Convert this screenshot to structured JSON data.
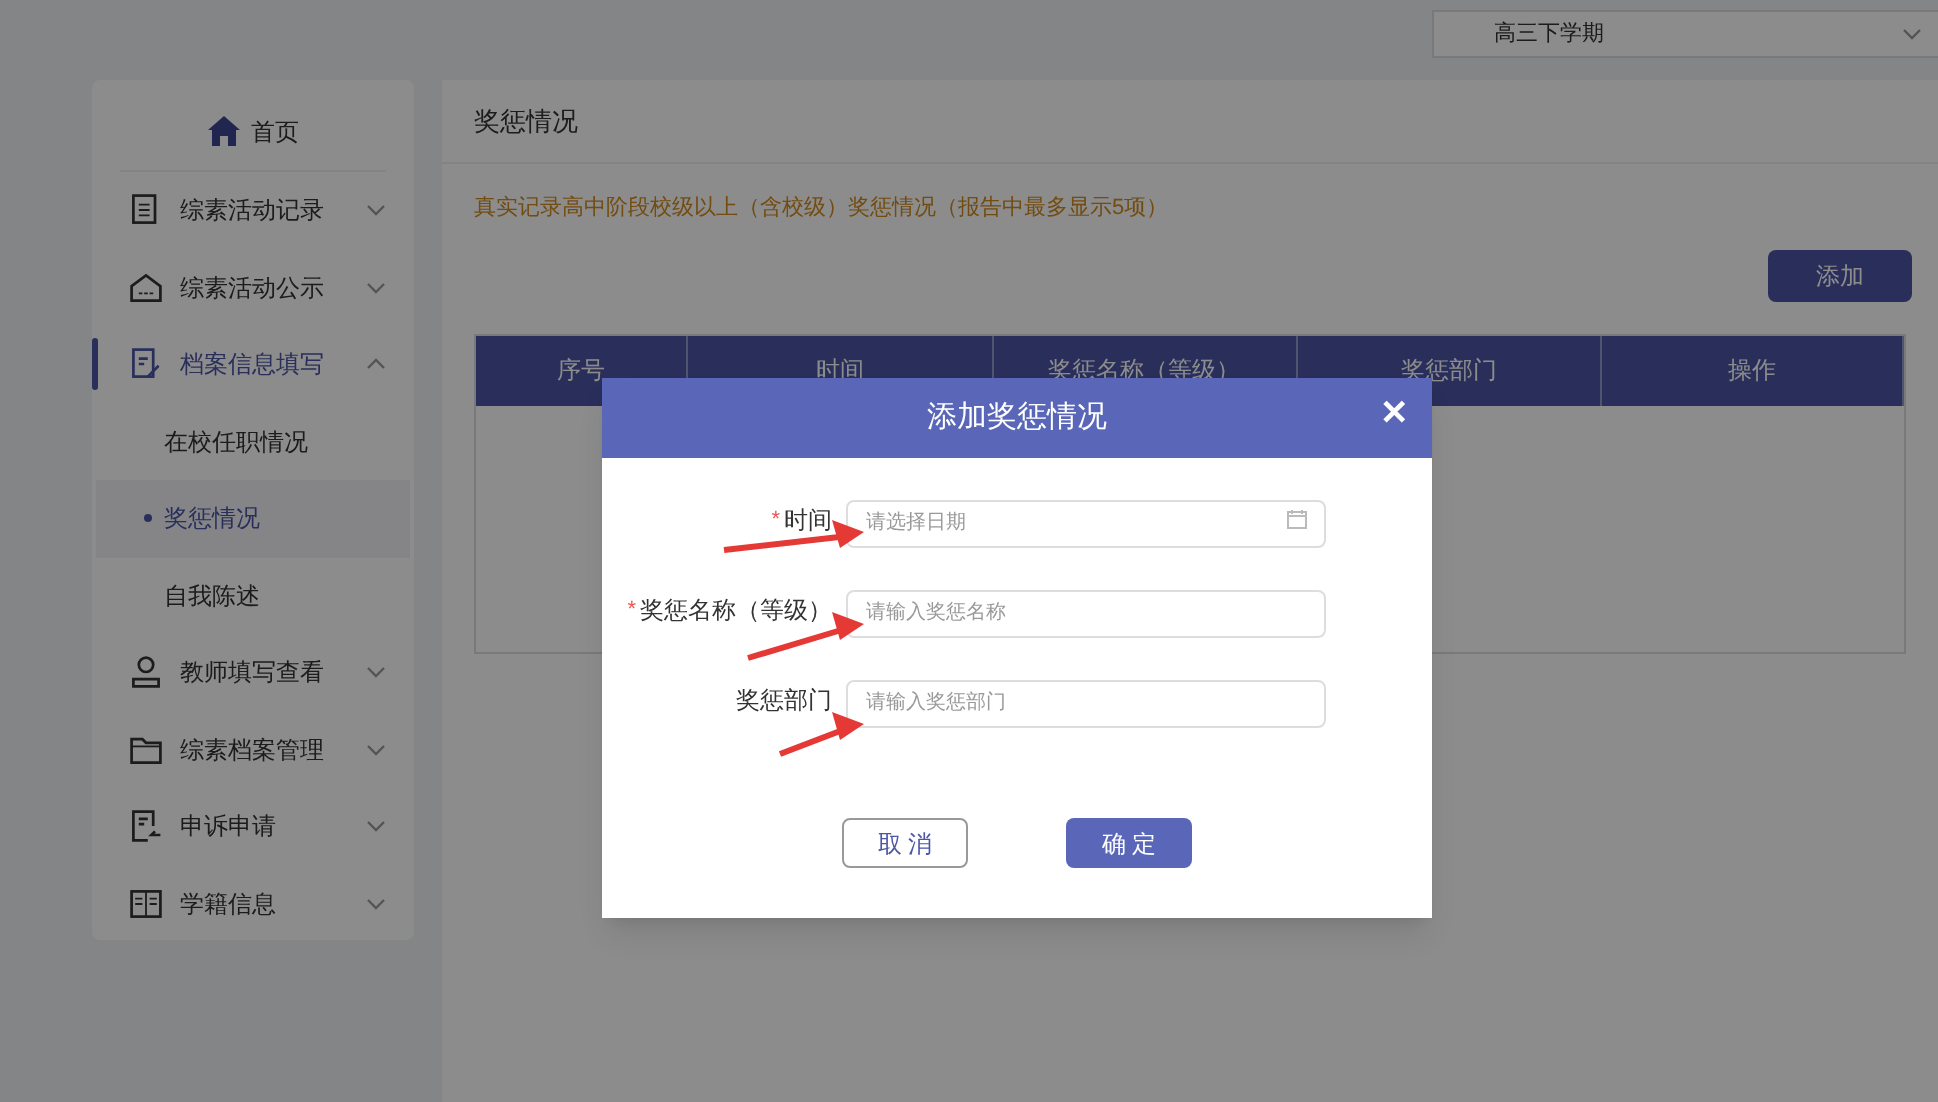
{
  "term_select": {
    "value": "高三下学期"
  },
  "sidebar": {
    "home": "首页",
    "items": [
      {
        "label": "综素活动记录",
        "expanded": false
      },
      {
        "label": "综素活动公示",
        "expanded": false
      },
      {
        "label": "档案信息填写",
        "expanded": true,
        "children": [
          {
            "label": "在校任职情况",
            "selected": false
          },
          {
            "label": "奖惩情况",
            "selected": true
          },
          {
            "label": "自我陈述",
            "selected": false
          }
        ]
      },
      {
        "label": "教师填写查看",
        "expanded": false
      },
      {
        "label": "综素档案管理",
        "expanded": false
      },
      {
        "label": "申诉申请",
        "expanded": false
      },
      {
        "label": "学籍信息",
        "expanded": false
      }
    ]
  },
  "page_title": "奖惩情况",
  "notice": "真实记录高中阶段校级以上（含校级）奖惩情况（报告中最多显示5项）",
  "add_button": "添加",
  "table": {
    "columns": [
      "序号",
      "时间",
      "奖惩名称（等级）",
      "奖惩部门",
      "操作"
    ]
  },
  "dialog": {
    "title": "添加奖惩情况",
    "close": "✕",
    "fields": [
      {
        "label": "时间",
        "required_mark": "*",
        "placeholder": "请选择日期",
        "kind": "date"
      },
      {
        "label": "奖惩名称（等级）",
        "required_mark": "*",
        "placeholder": "请输入奖惩名称",
        "kind": "text"
      },
      {
        "label": "奖惩部门",
        "placeholder": "请输入奖惩部门",
        "kind": "text"
      }
    ],
    "cancel": "取 消",
    "confirm": "确 定"
  }
}
